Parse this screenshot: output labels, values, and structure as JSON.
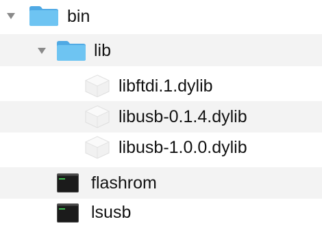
{
  "tree": {
    "items": [
      {
        "label": "bin",
        "icon": "folder-icon",
        "expanded": true,
        "level": 0
      },
      {
        "label": "lib",
        "icon": "folder-icon",
        "expanded": true,
        "level": 1
      },
      {
        "label": "libftdi.1.dylib",
        "icon": "dylib-file-icon",
        "level": 2
      },
      {
        "label": "libusb-0.1.4.dylib",
        "icon": "dylib-file-icon",
        "level": 2
      },
      {
        "label": "libusb-1.0.0.dylib",
        "icon": "dylib-file-icon",
        "level": 2
      },
      {
        "label": "flashrom",
        "icon": "unix-executable-icon",
        "level": 1
      },
      {
        "label": "lsusb",
        "icon": "unix-executable-icon",
        "level": 1
      }
    ]
  },
  "colors": {
    "folder": "#5ab5ec",
    "folder_tab": "#6ec4f2",
    "alt_row": "#f3f3f3",
    "disclosure": "#8a8a8a",
    "terminal_bg": "#1b1b1b",
    "terminal_prompt": "#3fbf52"
  }
}
